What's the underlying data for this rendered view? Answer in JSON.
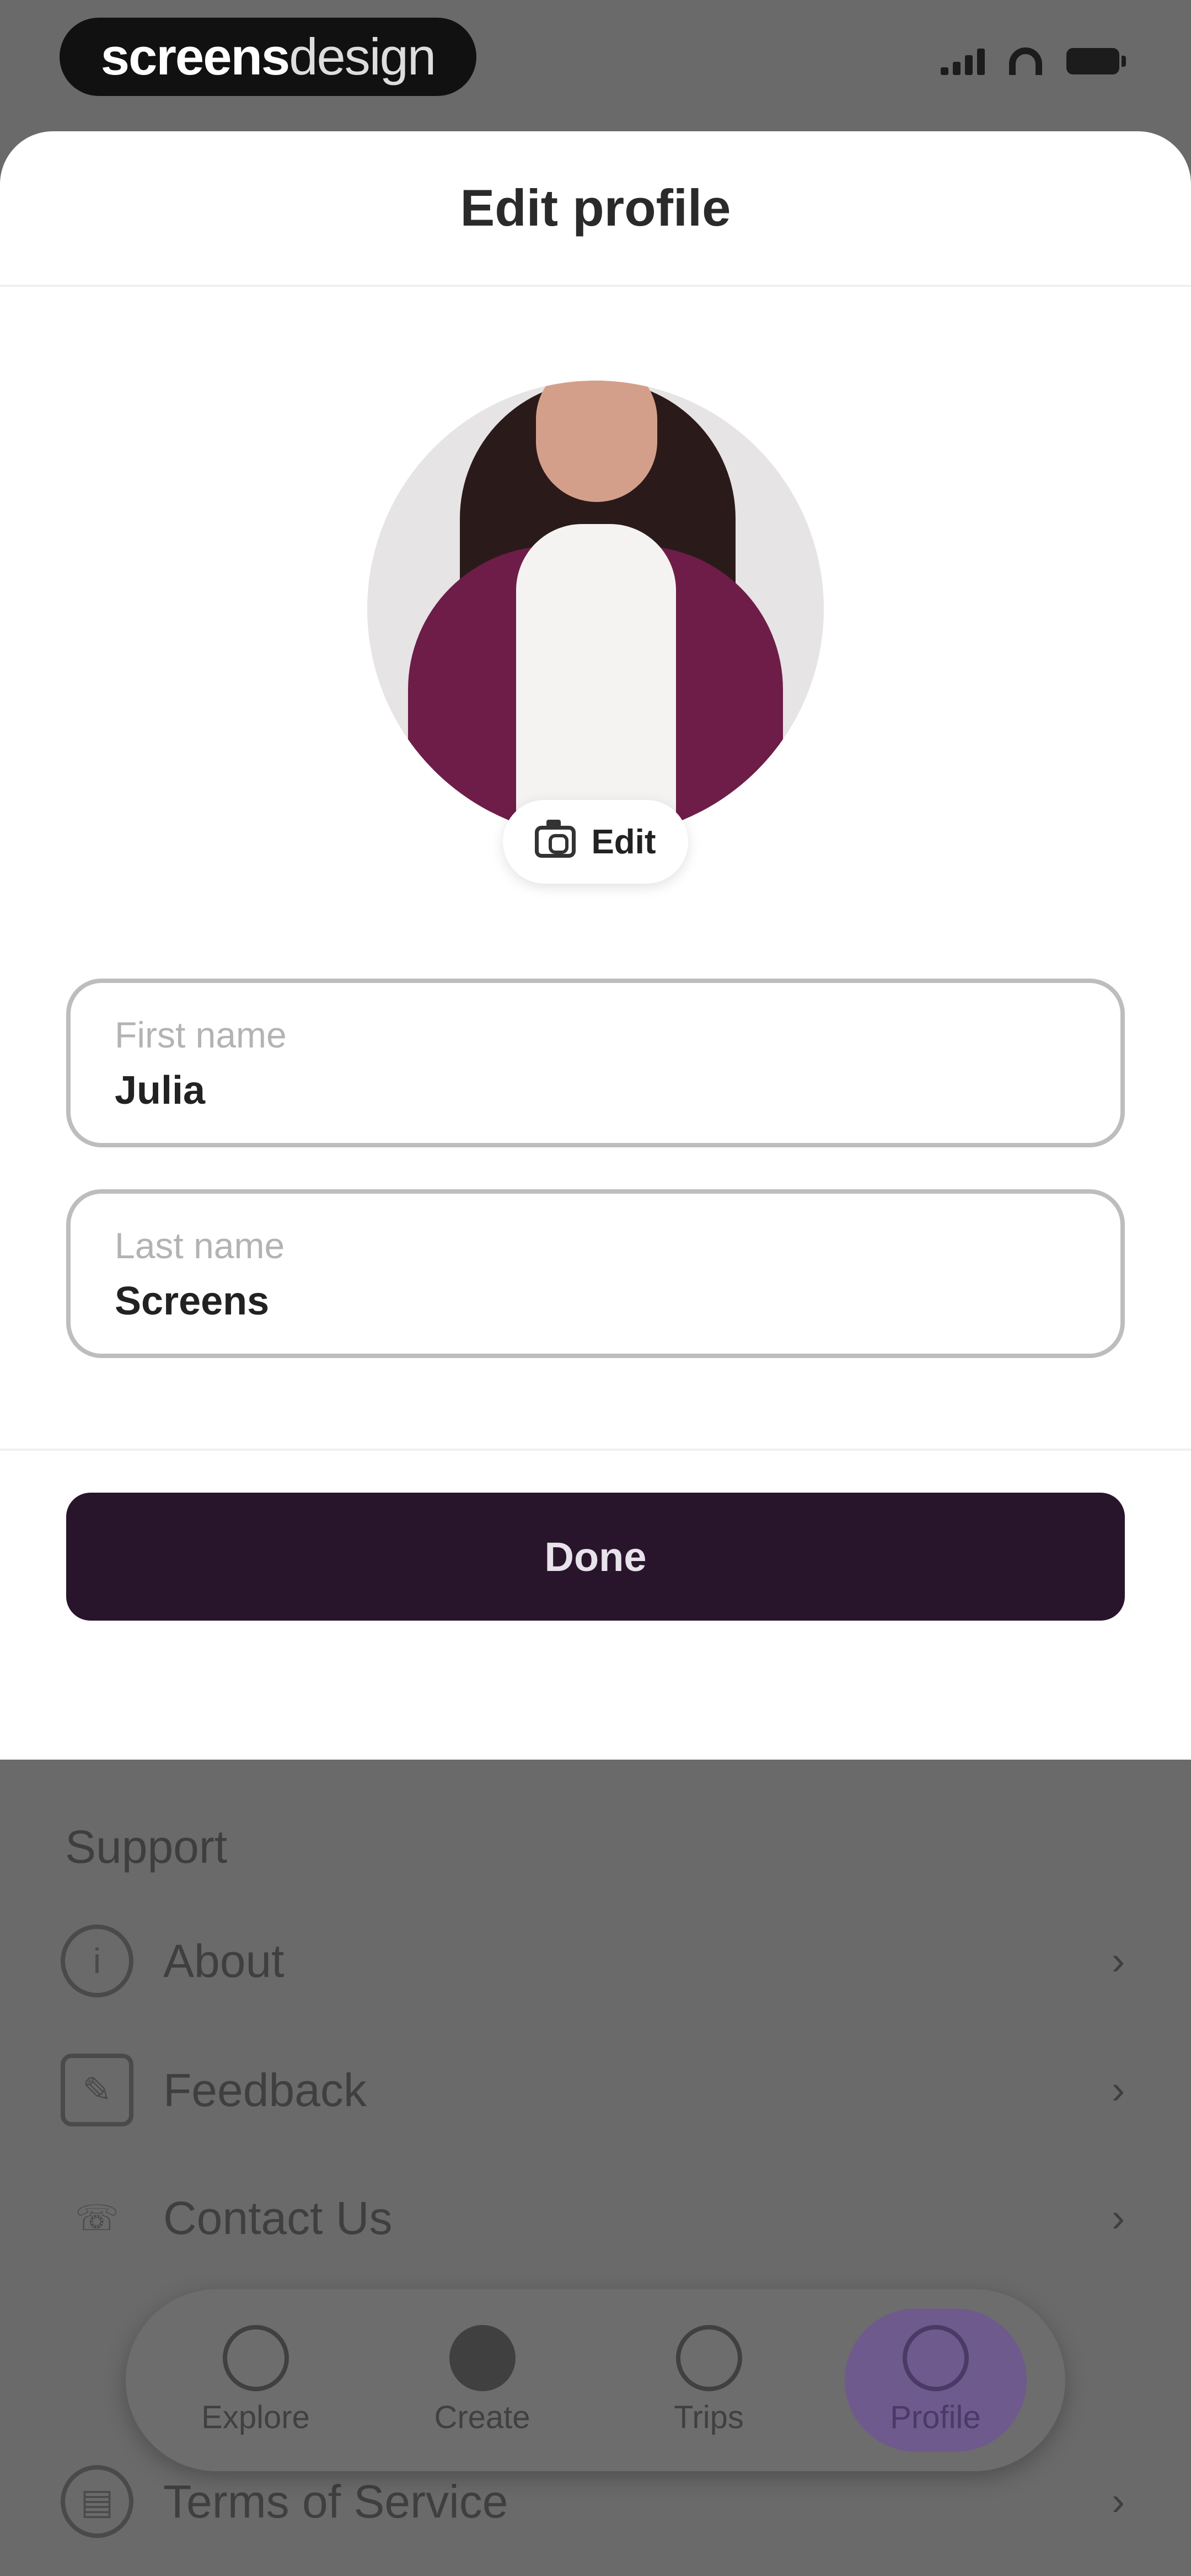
{
  "status_bar": {
    "brand_bold": "screens",
    "brand_light": "design"
  },
  "sheet": {
    "title": "Edit profile",
    "avatar_edit_label": "Edit",
    "first_name": {
      "label": "First name",
      "value": "Julia"
    },
    "last_name": {
      "label": "Last name",
      "value": "Screens"
    },
    "done_label": "Done"
  },
  "background": {
    "support_title": "Support",
    "rows": [
      {
        "label": "About",
        "icon": "info-icon"
      },
      {
        "label": "Feedback",
        "icon": "feedback-icon"
      },
      {
        "label": "Contact Us",
        "icon": "phone-icon"
      },
      {
        "label": "Terms of Service",
        "icon": "document-icon"
      }
    ],
    "nav": [
      {
        "label": "Explore",
        "icon": "explore-icon"
      },
      {
        "label": "Create",
        "icon": "create-icon"
      },
      {
        "label": "Trips",
        "icon": "trips-icon"
      },
      {
        "label": "Profile",
        "icon": "profile-icon",
        "active": true
      }
    ]
  },
  "colors": {
    "accent": "#28152b",
    "nav_active": "#6e5a8c",
    "jacket": "#6d1d48"
  }
}
